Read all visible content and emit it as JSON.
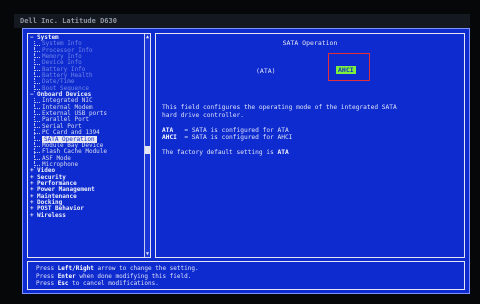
{
  "window": {
    "title": "Dell Inc. Latitude D630"
  },
  "tree": [
    {
      "label": "System",
      "level": 0,
      "toggle": "−",
      "selected": false,
      "dim": false
    },
    {
      "label": "System Info",
      "level": 1,
      "selected": false,
      "dim": true
    },
    {
      "label": "Processor Info",
      "level": 1,
      "selected": false,
      "dim": true
    },
    {
      "label": "Memory Info",
      "level": 1,
      "selected": false,
      "dim": true
    },
    {
      "label": "Device Info",
      "level": 1,
      "selected": false,
      "dim": true
    },
    {
      "label": "Battery Info",
      "level": 1,
      "selected": false,
      "dim": true
    },
    {
      "label": "Battery Health",
      "level": 1,
      "selected": false,
      "dim": true
    },
    {
      "label": "Date/Time",
      "level": 1,
      "selected": false,
      "dim": true
    },
    {
      "label": "Boot Sequence",
      "level": 1,
      "selected": false,
      "dim": true
    },
    {
      "label": "Onboard Devices",
      "level": 0,
      "toggle": "−",
      "selected": false,
      "dim": false
    },
    {
      "label": "Integrated NIC",
      "level": 1,
      "selected": false,
      "dim": false
    },
    {
      "label": "Internal Modem",
      "level": 1,
      "selected": false,
      "dim": false
    },
    {
      "label": "External USB ports",
      "level": 1,
      "selected": false,
      "dim": false
    },
    {
      "label": "Parallel Port",
      "level": 1,
      "selected": false,
      "dim": false
    },
    {
      "label": "Serial Port",
      "level": 1,
      "selected": false,
      "dim": false
    },
    {
      "label": "PC Card and 1394",
      "level": 1,
      "selected": false,
      "dim": false
    },
    {
      "label": "SATA Operation",
      "level": 1,
      "selected": true,
      "dim": false
    },
    {
      "label": "Module Bay Device",
      "level": 1,
      "selected": false,
      "dim": false
    },
    {
      "label": "Flash Cache Module",
      "level": 1,
      "selected": false,
      "dim": false
    },
    {
      "label": "ASF Mode",
      "level": 1,
      "selected": false,
      "dim": false
    },
    {
      "label": "Microphone",
      "level": 1,
      "selected": false,
      "dim": false
    },
    {
      "label": "Video",
      "level": 0,
      "toggle": "+",
      "selected": false,
      "dim": false
    },
    {
      "label": "Security",
      "level": 0,
      "toggle": "+",
      "selected": false,
      "dim": false
    },
    {
      "label": "Performance",
      "level": 0,
      "toggle": "+",
      "selected": false,
      "dim": false
    },
    {
      "label": "Power Management",
      "level": 0,
      "toggle": "+",
      "selected": false,
      "dim": false
    },
    {
      "label": "Maintenance",
      "level": 0,
      "toggle": "+",
      "selected": false,
      "dim": false
    },
    {
      "label": "Docking",
      "level": 0,
      "toggle": "+",
      "selected": false,
      "dim": false
    },
    {
      "label": "POST Behavior",
      "level": 0,
      "toggle": "+",
      "selected": false,
      "dim": false
    },
    {
      "label": "Wireless",
      "level": 0,
      "toggle": "+",
      "selected": false,
      "dim": false
    }
  ],
  "detail": {
    "title": "SATA Operation",
    "options": {
      "ata": "(ATA)",
      "ahci": "AHCI"
    },
    "selected_option": "AHCI",
    "desc_line1": "This field configures the operating mode of the integrated SATA",
    "desc_line2": "hard drive controller.",
    "ata_term": "ATA",
    "ata_text": "= SATA is configured for ATA",
    "ahci_term": "AHCI",
    "ahci_text": "= SATA is configured for AHCI",
    "default_prefix": "The factory default setting is",
    "default_value": "ATA"
  },
  "help": {
    "press": "Press",
    "line1_key": "Left/Right",
    "line1_text": "arrow to change the setting.",
    "line2_key": "Enter",
    "line2_text": "when done modifying this field.",
    "line3_key": "Esc",
    "line3_text": "to cancel modifications."
  },
  "colors": {
    "background": "#0e2bd0",
    "selection_highlight": "#7df03c",
    "focus_box": "#e0303a"
  }
}
